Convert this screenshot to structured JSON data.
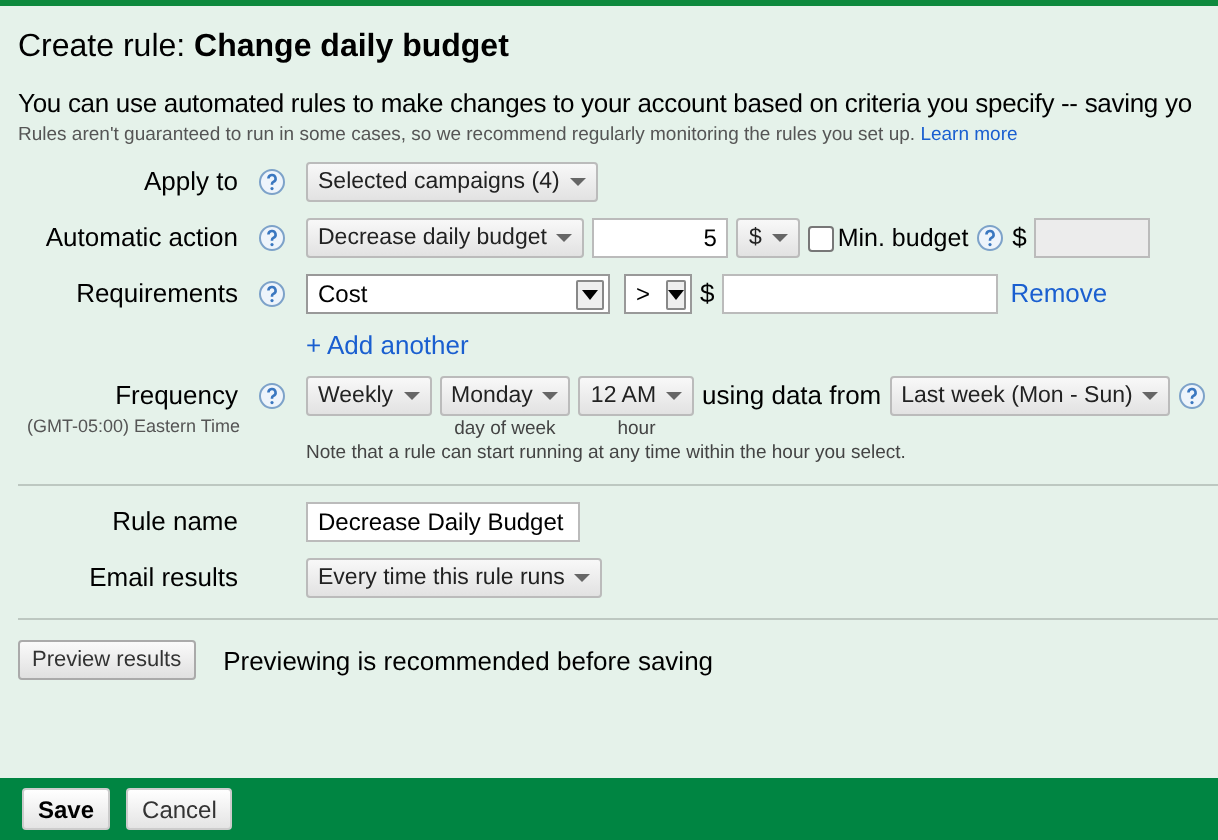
{
  "title": {
    "prefix": "Create rule:",
    "name": "Change daily budget"
  },
  "intro": "You can use automated rules to make changes to your account based on criteria you specify -- saving yo",
  "note": {
    "text": "Rules aren't guaranteed to run in some cases, so we recommend regularly monitoring the rules you set up.",
    "link": "Learn more"
  },
  "rows": [
    {
      "label": "Apply to",
      "help": true,
      "controls": [
        {
          "kind": "dropdown",
          "value": "Selected campaigns (4)"
        }
      ]
    },
    {
      "label": "Automatic action",
      "help": true,
      "controls": [
        {
          "kind": "dropdown",
          "value": "Decrease daily budget"
        },
        {
          "kind": "number",
          "value": "5"
        },
        {
          "kind": "dropdown",
          "value": "$"
        },
        {
          "kind": "checkbox",
          "label": "Min. budget",
          "checked": false
        },
        {
          "kind": "help"
        },
        {
          "kind": "text",
          "value": "$"
        },
        {
          "kind": "input",
          "disabled": true
        }
      ]
    },
    {
      "label": "Requirements",
      "help": true,
      "controls": [
        {
          "kind": "select",
          "value": "Cost"
        },
        {
          "kind": "select",
          "value": ">"
        },
        {
          "kind": "text",
          "value": "$"
        },
        {
          "kind": "input",
          "disabled": false
        },
        {
          "kind": "link",
          "value": "Remove"
        }
      ],
      "add_link": "+ Add another"
    },
    {
      "label": "Frequency",
      "sublabel": "(GMT-05:00) Eastern Time",
      "help": true,
      "controls": [
        {
          "kind": "dropdown",
          "value": "Weekly"
        },
        {
          "kind": "dropdown",
          "value": "Monday",
          "caption": "day of week"
        },
        {
          "kind": "dropdown",
          "value": "12 AM",
          "caption": "hour"
        },
        {
          "kind": "text",
          "value": "using data from"
        },
        {
          "kind": "dropdown",
          "value": "Last week (Mon - Sun)"
        },
        {
          "kind": "help"
        }
      ],
      "note": "Note that a rule can start running at any time within the hour you select."
    },
    {
      "kind": "divider"
    },
    {
      "label": "Rule name",
      "help": false,
      "controls": [
        {
          "kind": "input",
          "value": "Decrease Daily Budget",
          "disabled": false
        }
      ]
    },
    {
      "label": "Email results",
      "help": false,
      "controls": [
        {
          "kind": "dropdown",
          "value": "Every time this rule runs"
        }
      ]
    },
    {
      "kind": "divider"
    }
  ],
  "preview": {
    "button": "Preview results",
    "message": "Previewing is recommended before saving"
  },
  "footer": [
    {
      "label": "Save",
      "kind": "primary"
    },
    {
      "label": "Cancel",
      "kind": "secondary"
    }
  ]
}
